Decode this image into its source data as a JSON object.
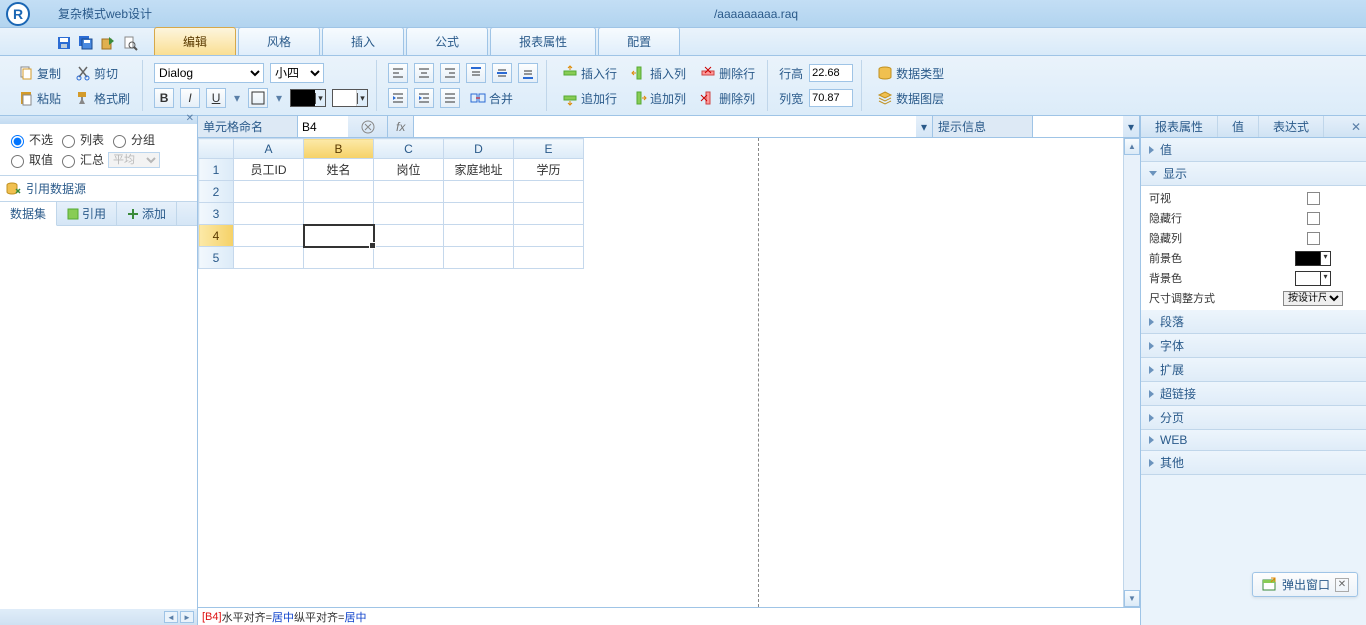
{
  "title": {
    "app": "复杂模式web设计",
    "file": "/aaaaaaaaa.raq"
  },
  "menu": {
    "tabs": [
      "编辑",
      "风格",
      "插入",
      "公式",
      "报表属性",
      "配置"
    ],
    "active": 0
  },
  "ribbon": {
    "clipboard": {
      "copy": "复制",
      "cut": "剪切",
      "paste": "粘贴",
      "format": "格式刷"
    },
    "font": {
      "family": "Dialog",
      "size": "小四"
    },
    "rows": {
      "insertRow": "插入行",
      "insertCol": "插入列",
      "deleteRow": "删除行",
      "appendRow": "追加行",
      "appendCol": "追加列",
      "deleteCol": "删除列"
    },
    "merge": "合并",
    "dims": {
      "rowH_lbl": "行高",
      "rowH": "22.68",
      "colW_lbl": "列宽",
      "colW": "70.87"
    },
    "data": {
      "type": "数据类型",
      "layer": "数据图层"
    }
  },
  "left": {
    "radios": {
      "r1": "不选",
      "r2": "列表",
      "r3": "分组",
      "r4": "取值",
      "r5": "汇总",
      "avg": "平均"
    },
    "quote": "引用数据源",
    "tabs": {
      "ds": "数据集",
      "quote": "引用",
      "add": "添加"
    }
  },
  "formula": {
    "label": "单元格命名",
    "cell": "B4",
    "hint": "提示信息"
  },
  "sheet": {
    "cols": [
      "A",
      "B",
      "C",
      "D",
      "E"
    ],
    "rows": [
      "1",
      "2",
      "3",
      "4",
      "5"
    ],
    "head": [
      "员工ID",
      "姓名",
      "岗位",
      "家庭地址",
      "学历"
    ],
    "selected": {
      "row": 4,
      "col": "B"
    }
  },
  "status": {
    "cell": "[B4]",
    "t1": " 水平对齐=",
    "v1": "居中",
    "t2": "  纵平对齐=",
    "v2": "居中"
  },
  "right": {
    "tabs": {
      "attr": "报表属性",
      "val": "值",
      "expr": "表达式"
    },
    "sections": {
      "value": "值",
      "display": "显示",
      "para": "段落",
      "font": "字体",
      "expand": "扩展",
      "link": "超链接",
      "page": "分页",
      "web": "WEB",
      "other": "其他"
    },
    "display": {
      "visible": "可视",
      "hideRow": "隐藏行",
      "hideCol": "隐藏列",
      "fg": "前景色",
      "bg": "背景色",
      "resize": "尺寸调整方式",
      "resize_v": "按设计尺寸不"
    }
  },
  "popup": "弹出窗口"
}
